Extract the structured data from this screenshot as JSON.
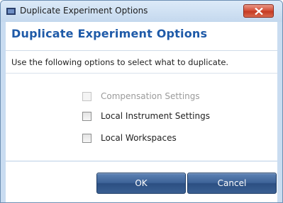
{
  "window": {
    "title": "Duplicate Experiment Options"
  },
  "dialog": {
    "heading": "Duplicate Experiment Options",
    "subtitle": "Use the following options to select what to duplicate.",
    "options": [
      {
        "label": "Compensation Settings",
        "checked": false,
        "enabled": false
      },
      {
        "label": "Local Instrument Settings",
        "checked": false,
        "enabled": true
      },
      {
        "label": "Local Workspaces",
        "checked": false,
        "enabled": true
      }
    ],
    "ok_label": "OK",
    "cancel_label": "Cancel"
  },
  "colors": {
    "heading": "#1e5aa8",
    "button": "#3e6398",
    "close_button": "#d5533c",
    "titlebar": "#c9dcf1"
  },
  "icons": {
    "app": "app-icon",
    "close": "close-icon"
  }
}
